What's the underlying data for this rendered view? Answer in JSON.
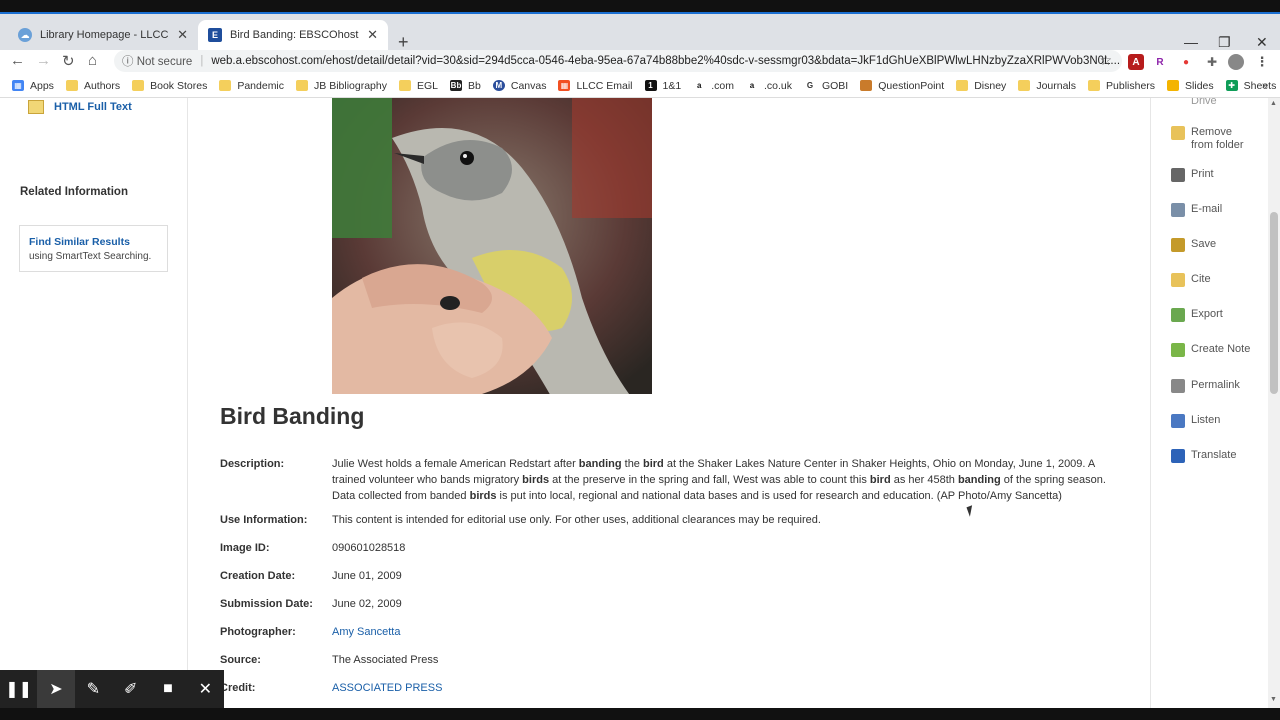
{
  "browser": {
    "tabs": [
      {
        "title": "Library Homepage - LLCC Library",
        "active": false
      },
      {
        "title": "Bird Banding: EBSCOhost",
        "active": true
      }
    ],
    "security_label": "Not secure",
    "url": "web.a.ebscohost.com/ehost/detail/detail?vid=30&sid=294d5cca-0546-4eba-95ea-67a74b88bbe2%40sdc-v-sessmgr03&bdata=JkF1dGhUeXBlPWlwLHNzbyZzaXRlPWVob3N0L...",
    "bookmarks": [
      "Apps",
      "Authors",
      "Book Stores",
      "Pandemic",
      "JB Bibliography",
      "EGL",
      "Bb",
      "Canvas",
      "LLCC Email",
      "1&1",
      ".com",
      ".co.uk",
      "GOBI",
      "QuestionPoint",
      "Disney",
      "Journals",
      "Publishers",
      "Slides",
      "Sheets"
    ],
    "bookmarks_more": "»"
  },
  "left": {
    "html_full_text": "HTML Full Text",
    "related_heading": "Related Information",
    "find_similar": "Find Similar Results",
    "find_similar_sub": "using SmartText Searching."
  },
  "record": {
    "title": "Bird Banding",
    "fields": [
      {
        "label": "Description:",
        "value": ""
      },
      {
        "label": "Use Information:",
        "value": "This content is intended for editorial use only. For other uses, additional clearances may be required."
      },
      {
        "label": "Image ID:",
        "value": "090601028518"
      },
      {
        "label": "Creation Date:",
        "value": "June 01, 2009"
      },
      {
        "label": "Submission Date:",
        "value": "June 02, 2009"
      },
      {
        "label": "Photographer:",
        "value": "Amy Sancetta"
      },
      {
        "label": "Source:",
        "value": "The Associated Press"
      },
      {
        "label": "Credit:",
        "value": "ASSOCIATED PRESS"
      }
    ],
    "description_parts": [
      {
        "t": "Julie West holds a female American Redstart after ",
        "b": false
      },
      {
        "t": "banding",
        "b": true
      },
      {
        "t": " the ",
        "b": false
      },
      {
        "t": "bird",
        "b": true
      },
      {
        "t": " at the Shaker Lakes Nature Center in Shaker Heights, Ohio on Monday, June 1, 2009. A trained volunteer who bands migratory ",
        "b": false
      },
      {
        "t": "birds",
        "b": true
      },
      {
        "t": " at the preserve in the spring and fall, West was able to count this ",
        "b": false
      },
      {
        "t": "bird",
        "b": true
      },
      {
        "t": " as her 458th ",
        "b": false
      },
      {
        "t": "banding",
        "b": true
      },
      {
        "t": " of the spring season. Data collected from banded ",
        "b": false
      },
      {
        "t": "birds",
        "b": true
      },
      {
        "t": " is put into local, regional and national data bases and is used for research and education. (AP Photo/Amy Sancetta)",
        "b": false
      }
    ]
  },
  "tools": {
    "partial_top": "Drive",
    "items": [
      {
        "label": "Remove from folder",
        "icon": "folder-remove-icon",
        "color": "#e8c25a"
      },
      {
        "label": "Print",
        "icon": "print-icon",
        "color": "#666666"
      },
      {
        "label": "E-mail",
        "icon": "email-icon",
        "color": "#7a8fa8"
      },
      {
        "label": "Save",
        "icon": "save-icon",
        "color": "#c49a2a"
      },
      {
        "label": "Cite",
        "icon": "cite-icon",
        "color": "#e8c25a"
      },
      {
        "label": "Export",
        "icon": "export-icon",
        "color": "#6aa84f"
      },
      {
        "label": "Create Note",
        "icon": "note-icon",
        "color": "#7ab648"
      },
      {
        "label": "Permalink",
        "icon": "link-icon",
        "color": "#888888"
      },
      {
        "label": "Listen",
        "icon": "speaker-icon",
        "color": "#4a78c2"
      },
      {
        "label": "Translate",
        "icon": "translate-icon",
        "color": "#2d63b8"
      }
    ]
  }
}
